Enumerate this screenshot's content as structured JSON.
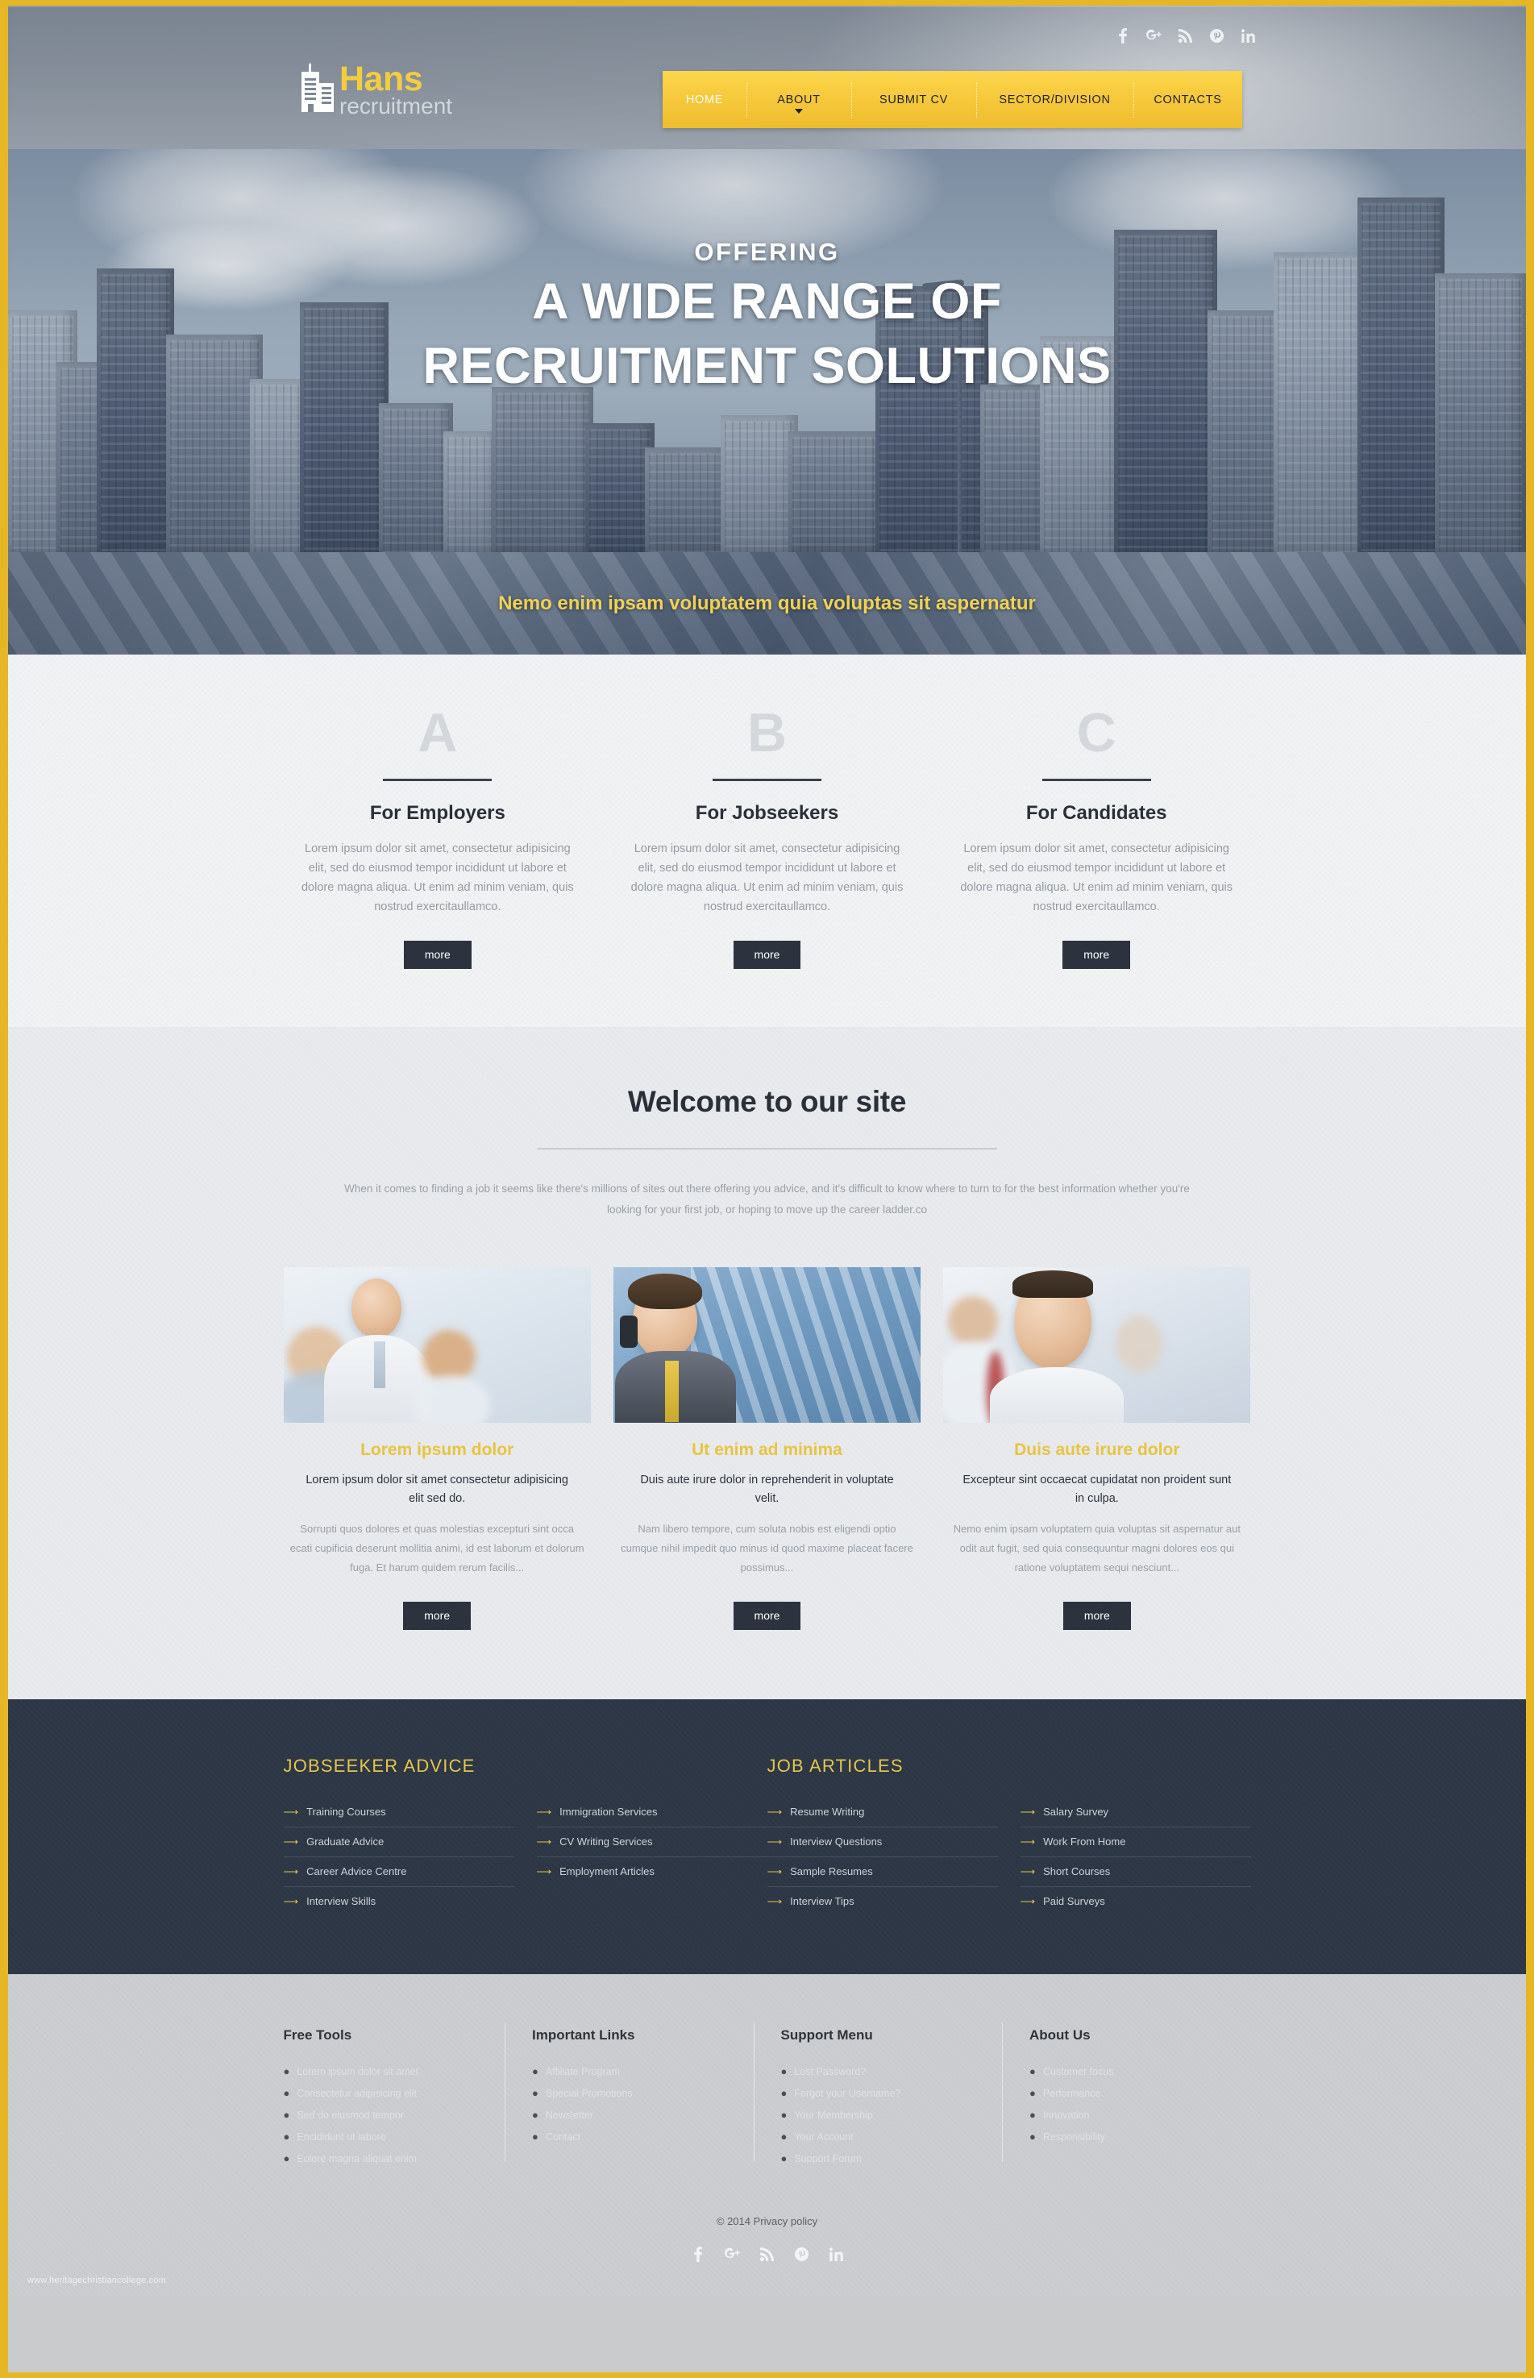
{
  "brand": {
    "name": "Hans",
    "tagline": "recruitment",
    "logo_icon": "building-icon",
    "accent_yellow": "#f3cd3e",
    "dark": "#2d3644"
  },
  "social_top": [
    {
      "name": "facebook-icon",
      "label": "f"
    },
    {
      "name": "google-plus-icon",
      "label": "g+"
    },
    {
      "name": "rss-icon",
      "label": "rss"
    },
    {
      "name": "pinterest-icon",
      "label": "p"
    },
    {
      "name": "linkedin-icon",
      "label": "in"
    }
  ],
  "nav": {
    "items": [
      {
        "label": "HOME",
        "active": true,
        "caret": false
      },
      {
        "label": "ABOUT",
        "active": false,
        "caret": true
      },
      {
        "label": "SUBMIT CV",
        "active": false,
        "caret": false
      },
      {
        "label": "SECTOR/DIVISION",
        "active": false,
        "caret": false
      },
      {
        "label": "CONTACTS",
        "active": false,
        "caret": false
      }
    ]
  },
  "hero": {
    "eyebrow": "OFFERING",
    "line1": "A WIDE RANGE OF",
    "line2": "RECRUITMENT SOLUTIONS",
    "prev": "←",
    "next": "→"
  },
  "tagline_bar": {
    "text": "Nemo enim ipsam voluptatem quia voluptas sit aspernatur"
  },
  "abc": {
    "columns": [
      {
        "letter": "A",
        "title": "For Employers",
        "text": "Lorem ipsum dolor sit amet, consectetur adipisicing elit, sed do eiusmod tempor incididunt ut labore et dolore magna aliqua. Ut enim ad minim veniam, quis nostrud exercitaullamco.",
        "button": "more"
      },
      {
        "letter": "B",
        "title": "For Jobseekers",
        "text": "Lorem ipsum dolor sit amet, consectetur adipisicing elit, sed do eiusmod tempor incididunt ut labore et dolore magna aliqua. Ut enim ad minim veniam, quis nostrud exercitaullamco.",
        "button": "more"
      },
      {
        "letter": "C",
        "title": "For Candidates",
        "text": "Lorem ipsum dolor sit amet, consectetur adipisicing elit, sed do eiusmod tempor incididunt ut labore et dolore magna aliqua. Ut enim ad minim veniam, quis nostrud exercitaullamco.",
        "button": "more"
      }
    ]
  },
  "welcome": {
    "title": "Welcome to our site",
    "text": "When it comes to finding a job it seems like there's millions of sites out there offering you advice, and it's difficult to know where to turn to for the best information whether you're looking for your first job, or hoping to move up the career ladder.co",
    "cards": [
      {
        "image": "business-team-photo",
        "title": "Lorem ipsum dolor",
        "subtitle": "Lorem ipsum dolor sit amet consectetur adipisicing elit sed do.",
        "body": "Sorrupti quos dolores et quas molestias excepturi sint occa ecati cupificia deserunt mollitia animi, id est laborum et dolorum fuga. Et harum quidem rerum facilis...",
        "button": "more"
      },
      {
        "image": "businessman-phone-photo",
        "title": "Ut enim ad minima",
        "subtitle": "Duis aute irure dolor in reprehenderit in voluptate velit.",
        "body": "Nam libero tempore, cum soluta nobis est eligendi optio cumque nihil impedit quo minus id quod maxime placeat facere possimus...",
        "button": "more"
      },
      {
        "image": "smiling-professional-photo",
        "title": "Duis aute irure dolor",
        "subtitle": "Excepteur sint occaecat cupidatat non proident sunt in culpa.",
        "body": "Nemo enim ipsam voluptatem quia voluptas sit aspernatur aut odit aut fugit, sed quia consequuntur magni dolores eos qui ratione voluptatem sequi nesciunt...",
        "button": "more"
      }
    ]
  },
  "dark_links": {
    "groups": [
      {
        "heading": "JOBSEEKER ADVICE",
        "columns": [
          [
            "Training Courses",
            "Graduate Advice",
            "Career Advice Centre",
            "Interview Skills"
          ],
          [
            "Immigration Services",
            "CV Writing Services",
            "Employment Articles"
          ]
        ]
      },
      {
        "heading": "JOB ARTICLES",
        "columns": [
          [
            "Resume Writing",
            "Interview Questions",
            "Sample Resumes",
            "Interview Tips"
          ],
          [
            "Salary Survey",
            "Work From Home",
            "Short Courses",
            "Paid Surveys"
          ]
        ]
      }
    ]
  },
  "footer": {
    "columns": [
      {
        "heading": "Free Tools",
        "items": [
          "Lorem ipsum dolor sit amet",
          "Consectetur adipisicing elit",
          "Sed do eiusmod tempor",
          "Encididunt ut labore",
          "Eolore magna aliquat enim"
        ]
      },
      {
        "heading": "Important Links",
        "items": [
          "Affiliate Program",
          "Special Promotions",
          "Newsletter",
          "Contact"
        ]
      },
      {
        "heading": "Support Menu",
        "items": [
          "Lost Password?",
          "Forgot your Username?",
          "Your Membership",
          "Your Account",
          "Support Forum"
        ]
      },
      {
        "heading": "About Us",
        "items": [
          "Customer focus",
          "Performance",
          "Innovation",
          "Responsibility"
        ]
      }
    ],
    "copyright": "© 2014 ",
    "privacy_link": "Privacy policy",
    "watermark": "www.heritagechristiancollege.com",
    "social": [
      {
        "name": "facebook-icon"
      },
      {
        "name": "google-plus-icon"
      },
      {
        "name": "rss-icon"
      },
      {
        "name": "pinterest-icon"
      },
      {
        "name": "linkedin-icon"
      }
    ]
  }
}
